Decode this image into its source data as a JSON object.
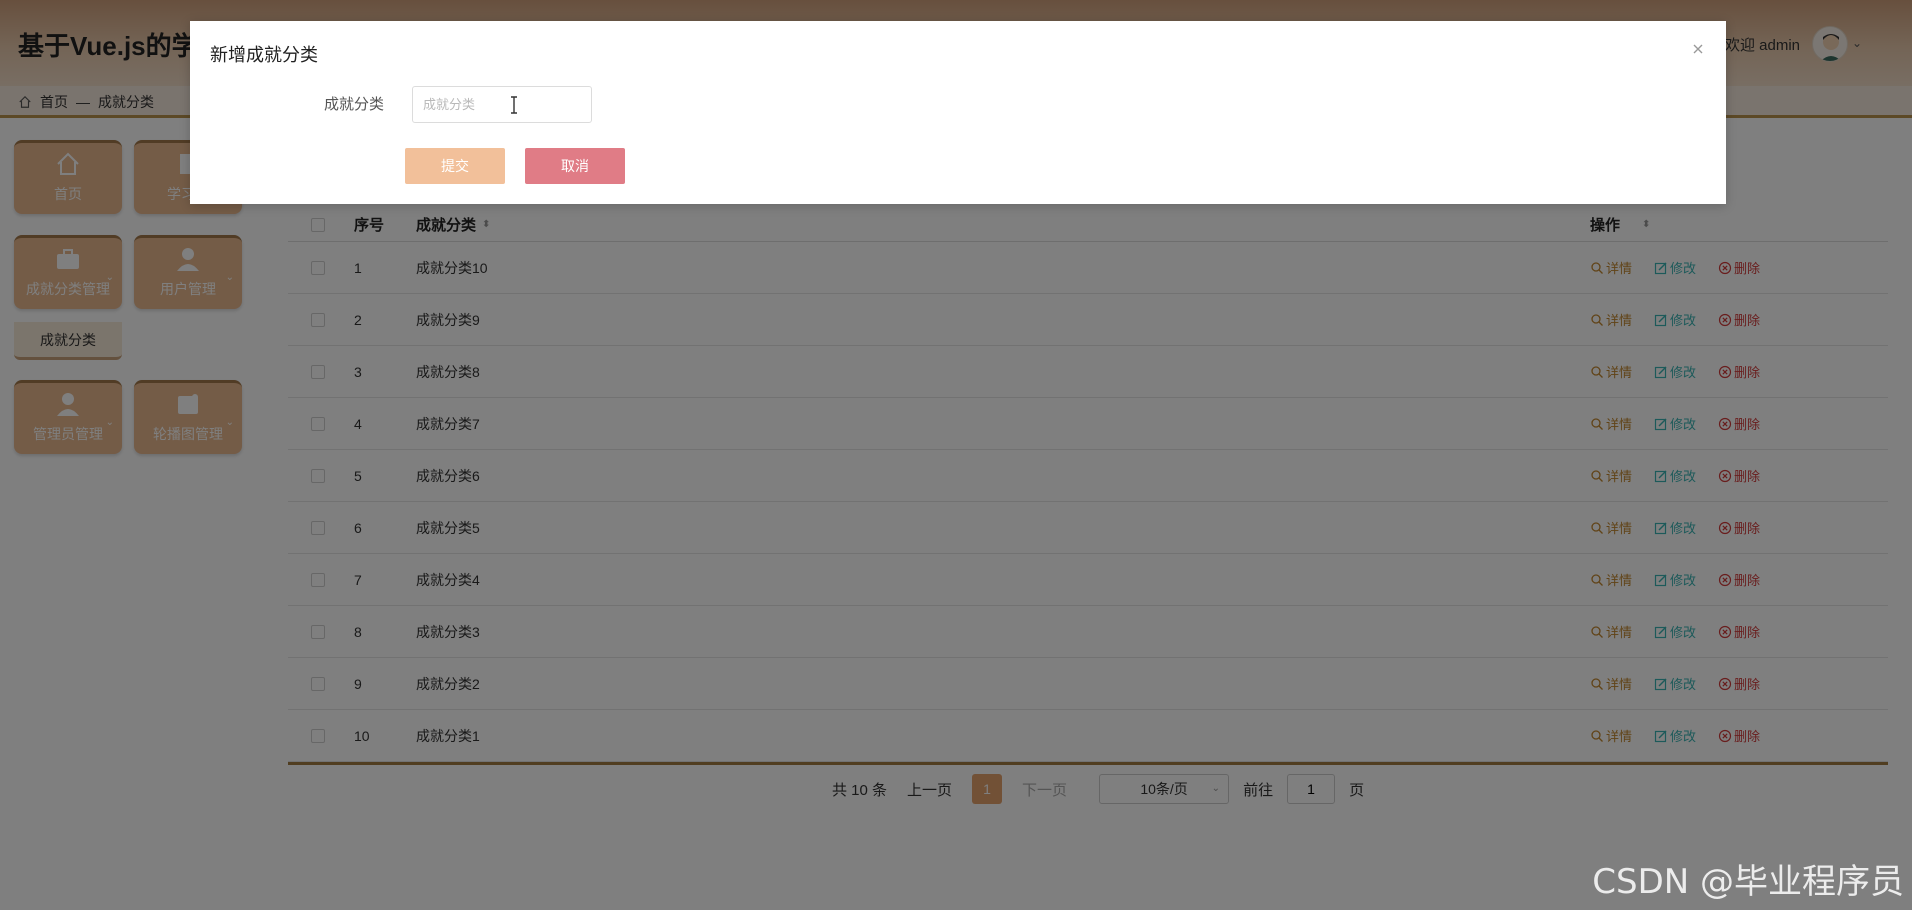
{
  "header": {
    "title": "基于Vue.js的学生",
    "welcome": "欢迎 admin",
    "avatar_icon": "user-avatar-icon"
  },
  "breadcrumb": {
    "home": "首页",
    "separator": "—",
    "current": "成就分类"
  },
  "sidebar": {
    "items": [
      {
        "label": "首页",
        "icon": "home-icon"
      },
      {
        "label": "学习成",
        "icon": "book-icon"
      },
      {
        "label": "成就分类管理",
        "icon": "briefcase-icon"
      },
      {
        "label": "用户管理",
        "icon": "user-icon"
      },
      {
        "label": "管理员管理",
        "icon": "admin-icon"
      },
      {
        "label": "轮播图管理",
        "icon": "image-icon"
      }
    ],
    "submenu_item": "成就分类"
  },
  "table": {
    "headers": {
      "index": "序号",
      "name": "成就分类",
      "ops": "操作"
    },
    "op_labels": {
      "detail": "详情",
      "edit": "修改",
      "delete": "删除"
    },
    "rows": [
      {
        "index": "1",
        "name": "成就分类10"
      },
      {
        "index": "2",
        "name": "成就分类9"
      },
      {
        "index": "3",
        "name": "成就分类8"
      },
      {
        "index": "4",
        "name": "成就分类7"
      },
      {
        "index": "5",
        "name": "成就分类6"
      },
      {
        "index": "6",
        "name": "成就分类5"
      },
      {
        "index": "7",
        "name": "成就分类4"
      },
      {
        "index": "8",
        "name": "成就分类3"
      },
      {
        "index": "9",
        "name": "成就分类2"
      },
      {
        "index": "10",
        "name": "成就分类1"
      }
    ]
  },
  "pagination": {
    "total": "共 10 条",
    "prev": "上一页",
    "current": "1",
    "next": "下一页",
    "page_size": "10条/页",
    "goto": "前往",
    "goto_value": "1",
    "page_unit": "页"
  },
  "dialog": {
    "title": "新增成就分类",
    "field_label": "成就分类",
    "field_placeholder": "成就分类",
    "field_value": "",
    "submit": "提交",
    "cancel": "取消"
  },
  "watermark": "CSDN @毕业程序员",
  "colors": {
    "accent": "#e4a36d",
    "submit": "#f2c09a",
    "cancel": "#e07c86",
    "detail": "#c2872e",
    "edit": "#3ab4b4",
    "delete": "#d23b3b"
  }
}
